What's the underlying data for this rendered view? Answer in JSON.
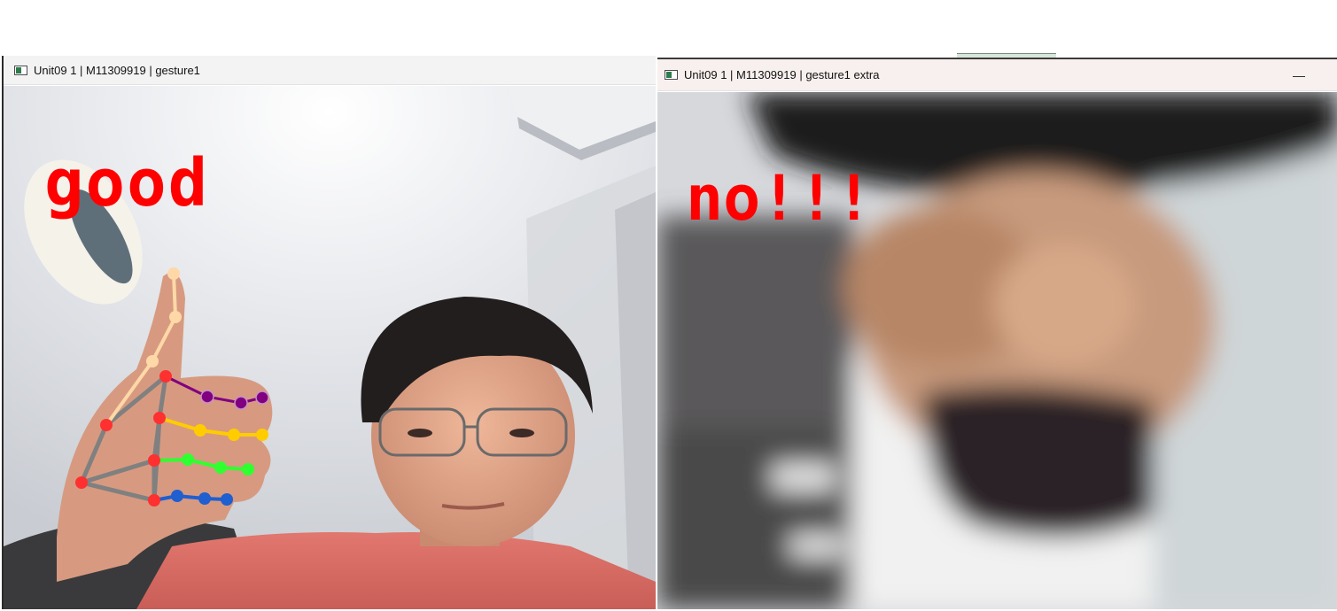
{
  "windows": [
    {
      "title": "Unit09  1 | M11309919 | gesture1",
      "overlay_text": "good",
      "overlay_color": "#ff0000"
    },
    {
      "title": "Unit09  1 | M11309919 | gesture1 extra",
      "overlay_text": "no!!!",
      "overlay_color": "#ff0000",
      "minimize_label": "—"
    }
  ],
  "icons": {
    "window_icon": "app-window-icon",
    "minimize": "minimize-icon"
  },
  "landmark_colors": {
    "thumb": "#ffd8a8",
    "index": "#800080",
    "middle": "#ffcc00",
    "ring": "#30ff30",
    "pinky": "#1f5fd0",
    "palm": "#808080",
    "joint": "#ff3030"
  }
}
